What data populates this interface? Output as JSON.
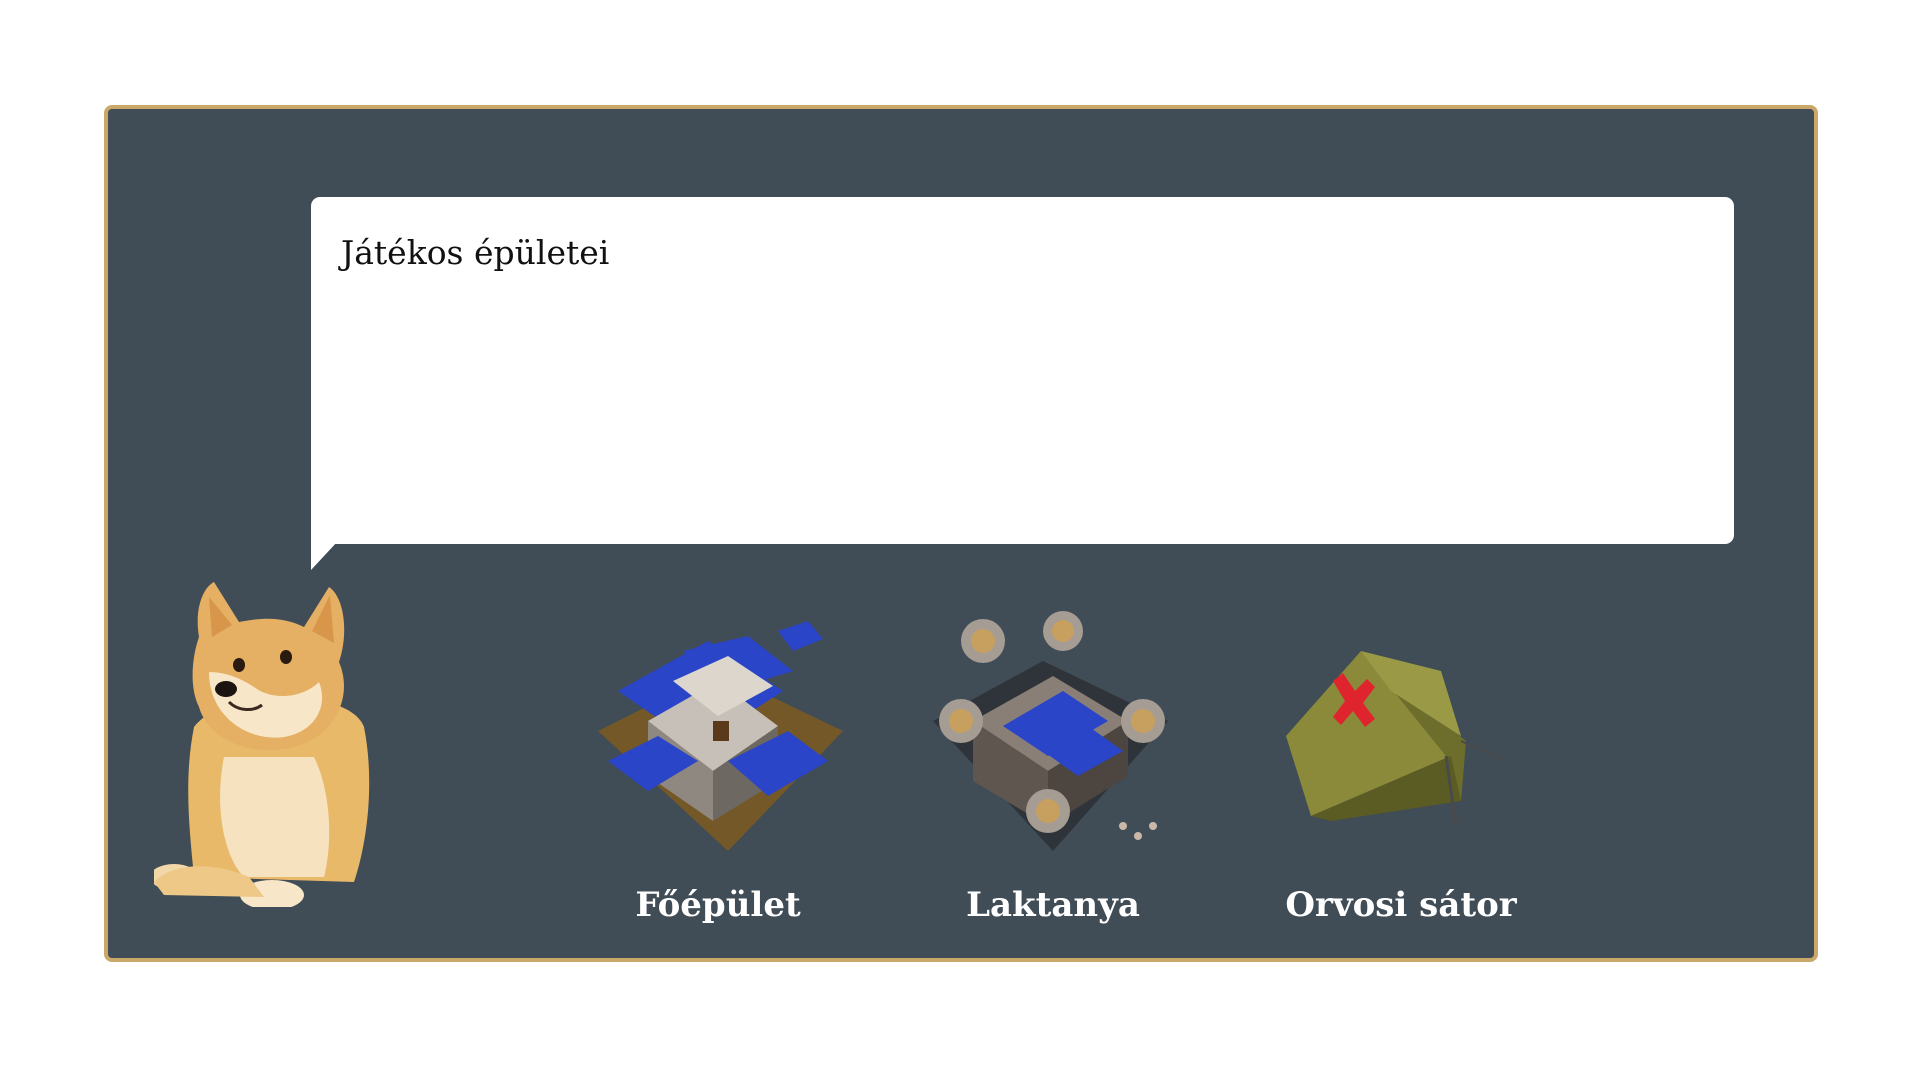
{
  "dialog": {
    "title": "Játékos épületei"
  },
  "buildings": [
    {
      "label": "Főépület",
      "icon": "castle-main-building-icon"
    },
    {
      "label": "Laktanya",
      "icon": "barracks-fortress-icon"
    },
    {
      "label": "Orvosi sátor",
      "icon": "medical-tent-icon"
    }
  ],
  "colors": {
    "panel_bg": "#404c56",
    "panel_border": "#c9a86a",
    "bubble_bg": "#ffffff",
    "label_text": "#ffffff",
    "accent_blue": "#2a45c8",
    "cross_red": "#e0242e"
  }
}
